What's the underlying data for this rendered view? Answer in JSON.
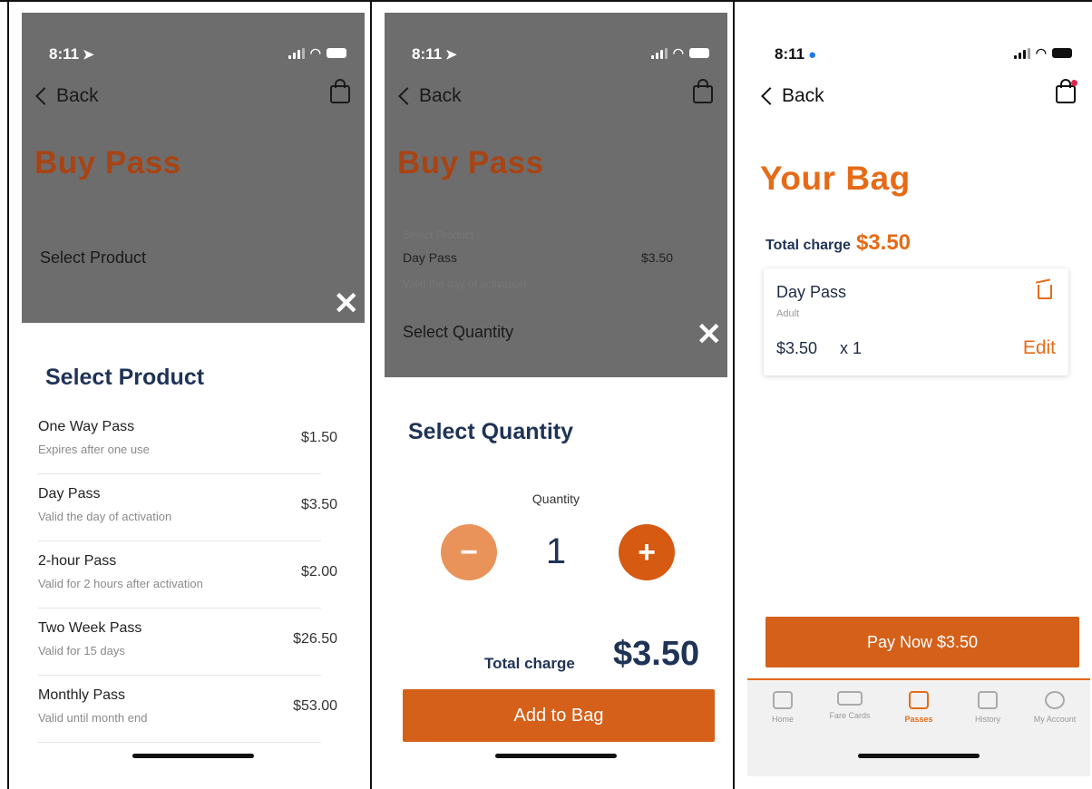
{
  "status": {
    "time": "8:11"
  },
  "nav": {
    "back_label": "Back"
  },
  "panel1": {
    "page_title": "Buy Pass",
    "field_label": "Select Product",
    "sheet_title": "Select Product",
    "products": [
      {
        "name": "One Way Pass",
        "desc": "Expires after one use",
        "price": "$1.50"
      },
      {
        "name": "Day Pass",
        "desc": "Valid the day of activation",
        "price": "$3.50"
      },
      {
        "name": "2-hour Pass",
        "desc": "Valid for 2 hours after activation",
        "price": "$2.00"
      },
      {
        "name": "Two Week Pass",
        "desc": "Valid for 15 days",
        "price": "$26.50"
      },
      {
        "name": "Monthly Pass",
        "desc": "Valid until month end",
        "price": "$53.00"
      }
    ]
  },
  "panel2": {
    "page_title": "Buy Pass",
    "select_product_small": "Select Product",
    "selected_name": "Day Pass",
    "selected_price": "$3.50",
    "selected_desc": "Valid the day of activation",
    "field_label": "Select Quantity",
    "sheet_title": "Select Quantity",
    "quantity_label": "Quantity",
    "quantity": "1",
    "total_label": "Total charge",
    "total_value": "$3.50",
    "add_button": "Add to Bag"
  },
  "panel3": {
    "page_title": "Your Bag",
    "total_label": "Total charge",
    "total_value": "$3.50",
    "item": {
      "name": "Day Pass",
      "type": "Adult",
      "price": "$3.50",
      "qty": "x 1",
      "edit": "Edit"
    },
    "pay_button": "Pay Now  $3.50",
    "tabs": [
      {
        "label": "Home",
        "icon": "home-icon"
      },
      {
        "label": "Fare Cards",
        "icon": "card-icon"
      },
      {
        "label": "Passes",
        "icon": "ticket-icon",
        "active": true
      },
      {
        "label": "History",
        "icon": "calendar-icon"
      },
      {
        "label": "My Account",
        "icon": "account-icon"
      }
    ]
  },
  "colors": {
    "accent": "#e66b17",
    "dim": "#6d6d6d",
    "navy": "#1f3356"
  }
}
